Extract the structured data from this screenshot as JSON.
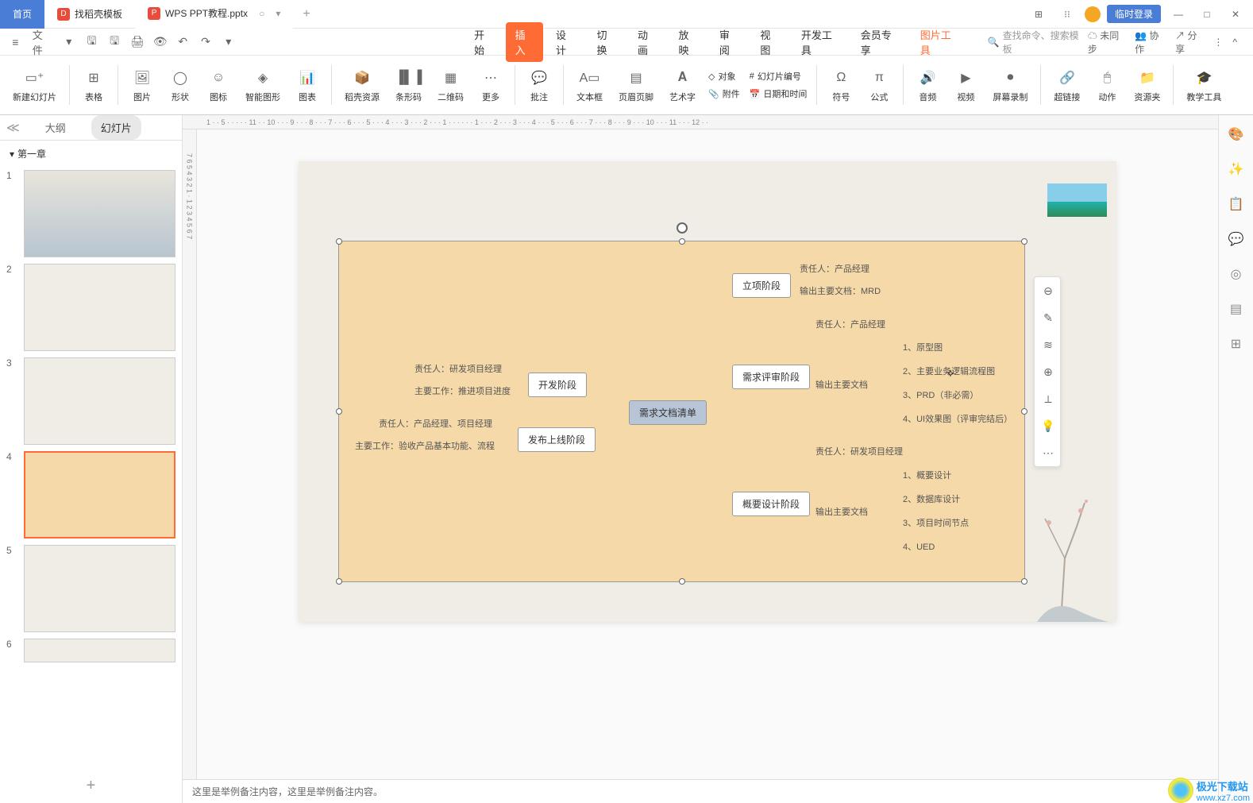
{
  "titleBar": {
    "homeTab": "首页",
    "templateTab": "找稻壳模板",
    "fileTab": "WPS PPT教程.pptx",
    "loginBtn": "临时登录"
  },
  "quickAccess": {
    "fileMenu": "文件"
  },
  "menuTabs": {
    "start": "开始",
    "insert": "插入",
    "design": "设计",
    "transition": "切换",
    "animation": "动画",
    "show": "放映",
    "review": "审阅",
    "view": "视图",
    "devTools": "开发工具",
    "member": "会员专享",
    "imgTools": "图片工具"
  },
  "searchPlaceholder": "查找命令、搜索模板",
  "rightTools": {
    "unsync": "未同步",
    "collab": "协作",
    "share": "分享"
  },
  "ribbon": {
    "newSlide": "新建幻灯片",
    "table": "表格",
    "picture": "图片",
    "shape": "形状",
    "icon": "图标",
    "smartArt": "智能图形",
    "chart": "图表",
    "resource": "稻壳资源",
    "barcode": "条形码",
    "qrcode": "二维码",
    "more": "更多",
    "comment": "批注",
    "textbox": "文本框",
    "headerFooter": "页眉页脚",
    "wordArt": "艺术字",
    "object": "对象",
    "attachment": "附件",
    "slideNum": "幻灯片编号",
    "datetime": "日期和时间",
    "symbol": "符号",
    "equation": "公式",
    "audio": "音频",
    "video": "视频",
    "screenRec": "屏幕录制",
    "hyperlink": "超链接",
    "action": "动作",
    "resFolder": "资源夹",
    "teachTools": "教学工具"
  },
  "leftPanel": {
    "outline": "大纲",
    "slides": "幻灯片",
    "chapter": "第一章"
  },
  "mindmap": {
    "root": "需求文档清单",
    "dev": "开发阶段",
    "devResp": "责任人：研发项目经理",
    "devWork": "主要工作：推进项目进度",
    "release": "发布上线阶段",
    "relResp": "责任人：产品经理、项目经理",
    "relWork": "主要工作：验收产品基本功能、流程",
    "init": "立项阶段",
    "initResp": "责任人：产品经理",
    "initDoc": "输出主要文档：MRD",
    "review": "需求评审阶段",
    "reviewResp": "责任人：产品经理",
    "reviewDoc": "输出主要文档",
    "r1": "1、原型图",
    "r2": "2、主要业务逻辑流程图",
    "r3": "3、PRD（非必需）",
    "r4": "4、UI效果图（评审完结后）",
    "outline": "概要设计阶段",
    "outResp": "责任人：研发项目经理",
    "outDoc": "输出主要文档",
    "o1": "1、概要设计",
    "o2": "2、数据库设计",
    "o3": "3、项目时间节点",
    "o4": "4、UED"
  },
  "notes": "这里是举例备注内容，这里是举例备注内容。",
  "slideNumbers": [
    "1",
    "2",
    "3",
    "4",
    "5",
    "6"
  ],
  "watermark": {
    "name": "极光下载站",
    "url": "www.xz7.com"
  }
}
